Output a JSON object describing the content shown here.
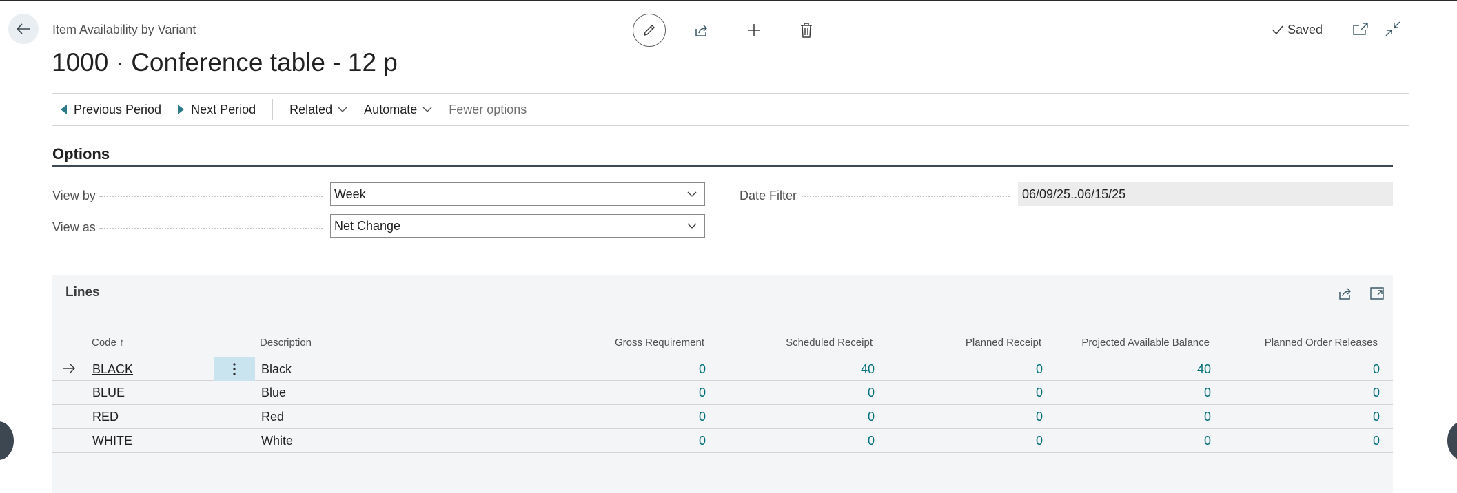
{
  "page": {
    "caption": "Item Availability by Variant",
    "title": "1000 · Conference table - 12 p",
    "status": "Saved"
  },
  "header_actions": [
    {
      "icon": "pencil-icon"
    },
    {
      "icon": "share-icon"
    },
    {
      "icon": "plus-icon"
    },
    {
      "icon": "trash-icon"
    }
  ],
  "actionbar": {
    "previous_period": "Previous Period",
    "next_period": "Next Period",
    "related": "Related",
    "automate": "Automate",
    "fewer_options": "Fewer options"
  },
  "options": {
    "heading": "Options",
    "view_by_label": "View by",
    "view_by_value": "Week",
    "view_as_label": "View as",
    "view_as_value": "Net Change",
    "date_filter_label": "Date Filter",
    "date_filter_value": "06/09/25..06/15/25"
  },
  "lines": {
    "title": "Lines",
    "columns": {
      "code": "Code",
      "code_sort": "↑",
      "description": "Description",
      "gross_requirement": "Gross Requirement",
      "scheduled_receipt": "Scheduled Receipt",
      "planned_receipt": "Planned Receipt",
      "projected_available_balance": "Projected Available Balance",
      "planned_order_releases": "Planned Order Releases"
    },
    "rows": [
      {
        "code": "BLACK",
        "description": "Black",
        "gross": "0",
        "scheduled": "40",
        "planned": "0",
        "projected": "40",
        "releases": "0"
      },
      {
        "code": "BLUE",
        "description": "Blue",
        "gross": "0",
        "scheduled": "0",
        "planned": "0",
        "projected": "0",
        "releases": "0"
      },
      {
        "code": "RED",
        "description": "Red",
        "gross": "0",
        "scheduled": "0",
        "planned": "0",
        "projected": "0",
        "releases": "0"
      },
      {
        "code": "WHITE",
        "description": "White",
        "gross": "0",
        "scheduled": "0",
        "planned": "0",
        "projected": "0",
        "releases": "0"
      }
    ]
  },
  "colors": {
    "accent": "#00707a",
    "selected_cell": "#c9e3ef",
    "part_background": "#f4f5f6"
  }
}
